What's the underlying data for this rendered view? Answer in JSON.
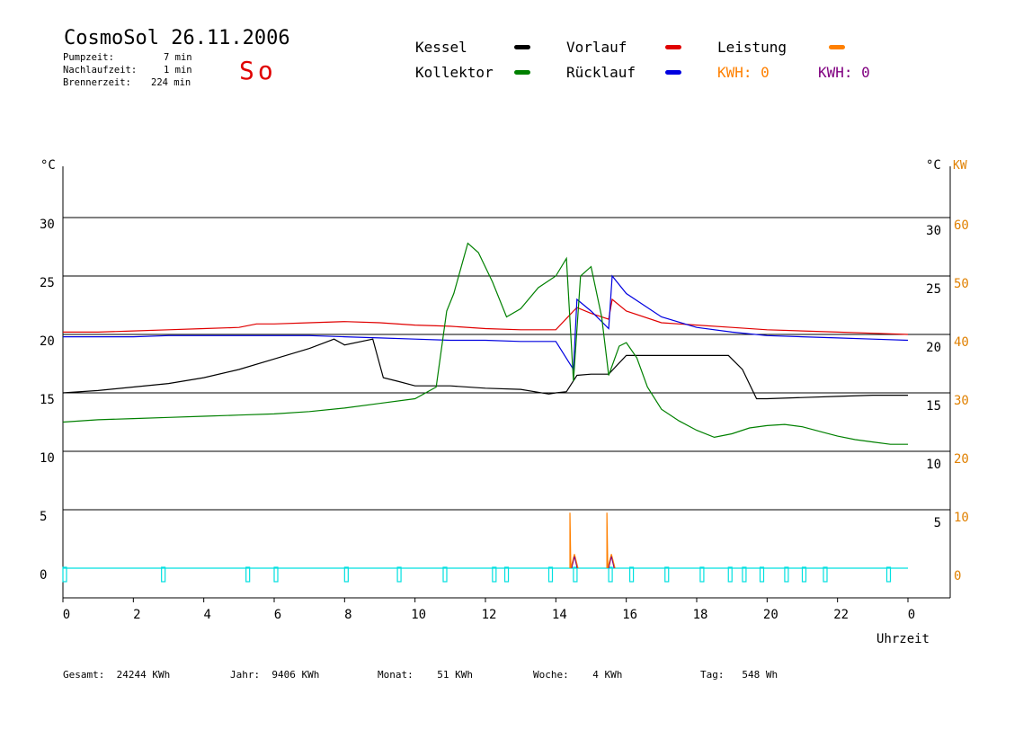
{
  "header": {
    "title": "CosmoSol 26.11.2006",
    "day": "So",
    "stats": [
      {
        "label": "Pumpzeit:",
        "value": "7 min"
      },
      {
        "label": "Nachlaufzeit:",
        "value": "1 min"
      },
      {
        "label": "Brennerzeit:",
        "value": "224 min"
      }
    ]
  },
  "legend": {
    "kessel": "Kessel",
    "kollektor": "Kollektor",
    "vorlauf": "Vorlauf",
    "ruecklauf": "Rücklauf",
    "leistung": "Leistung",
    "kwh1": "KWH: 0",
    "kwh2": "KWH: 0"
  },
  "colors": {
    "kessel": "#000000",
    "kollektor": "#008000",
    "vorlauf": "#e00000",
    "ruecklauf": "#0000e0",
    "leistung": "#ff8000",
    "kwh2": "#800080",
    "pump": "#00e0e0"
  },
  "footer": {
    "gesamt": "Gesamt:  24244 KWh",
    "jahr": "Jahr:  9406 KWh",
    "monat": "Monat:    51 KWh",
    "woche": "Woche:    4 KWh",
    "tag": "Tag:   548 Wh"
  },
  "chart_data": {
    "type": "line",
    "xlabel": "Uhrzeit",
    "ylabel_left": "°C",
    "ylabel_right": [
      "°C",
      "KW"
    ],
    "xlim": [
      0,
      24
    ],
    "ylim": [
      -2.5,
      35
    ],
    "x_ticks": [
      "0",
      "2",
      "4",
      "6",
      "8",
      "10",
      "12",
      "14",
      "16",
      "18",
      "20",
      "22",
      "0"
    ],
    "y_ticks_left": [
      "0",
      "5",
      "10",
      "15",
      "20",
      "25",
      "30"
    ],
    "y_ticks_right_c": [
      "5",
      "10",
      "15",
      "20",
      "25",
      "30"
    ],
    "y_ticks_right_kw": [
      "0",
      "10",
      "20",
      "30",
      "40",
      "50",
      "60"
    ],
    "grid": "horizontal",
    "series": [
      {
        "name": "Vorlauf",
        "color": "#e00000",
        "x": [
          0,
          1,
          2,
          3,
          4,
          5,
          5.5,
          6,
          7,
          8,
          9,
          10,
          11,
          12,
          13,
          14,
          14.5,
          14.6,
          15,
          15.5,
          15.6,
          16,
          17,
          18,
          19,
          20,
          21,
          22,
          23,
          24
        ],
        "y": [
          20.2,
          20.2,
          20.3,
          20.4,
          20.5,
          20.6,
          20.9,
          20.9,
          21.0,
          21.1,
          21.0,
          20.8,
          20.7,
          20.5,
          20.4,
          20.4,
          22.0,
          22.3,
          21.8,
          21.3,
          23.0,
          22.0,
          21.0,
          20.8,
          20.6,
          20.4,
          20.3,
          20.2,
          20.1,
          20.0
        ]
      },
      {
        "name": "Rücklauf",
        "color": "#0000e0",
        "x": [
          0,
          1,
          2,
          3,
          4,
          5,
          6,
          7,
          8,
          9,
          10,
          11,
          12,
          13,
          14,
          14.5,
          14.6,
          15,
          15.5,
          15.6,
          16,
          17,
          18,
          19,
          20,
          21,
          22,
          23,
          24
        ],
        "y": [
          19.8,
          19.8,
          19.8,
          19.9,
          19.9,
          19.9,
          19.9,
          19.9,
          19.8,
          19.7,
          19.6,
          19.5,
          19.5,
          19.4,
          19.4,
          17.0,
          23.0,
          22.0,
          20.5,
          25.0,
          23.5,
          21.5,
          20.6,
          20.2,
          19.9,
          19.8,
          19.7,
          19.6,
          19.5
        ]
      },
      {
        "name": "Kessel",
        "color": "#000000",
        "x": [
          0,
          1,
          2,
          3,
          4,
          5,
          6,
          7,
          7.7,
          8,
          8.8,
          9.1,
          9.5,
          10,
          11,
          12,
          13,
          13.8,
          14,
          14.3,
          14.6,
          15,
          15.5,
          16,
          17,
          18,
          18.9,
          19.3,
          19.7,
          20,
          21,
          22,
          23,
          24
        ],
        "y": [
          15.0,
          15.2,
          15.5,
          15.8,
          16.3,
          17.0,
          17.9,
          18.8,
          19.6,
          19.1,
          19.6,
          16.3,
          16.0,
          15.6,
          15.6,
          15.4,
          15.3,
          14.9,
          15.0,
          15.1,
          16.5,
          16.6,
          16.6,
          18.2,
          18.2,
          18.2,
          18.2,
          17.0,
          14.5,
          14.5,
          14.6,
          14.7,
          14.8,
          14.8
        ]
      },
      {
        "name": "Kollektor",
        "color": "#008000",
        "x": [
          0,
          1,
          2,
          3,
          4,
          5,
          6,
          7,
          8,
          9,
          10,
          10.6,
          10.9,
          11.1,
          11.5,
          11.8,
          12.2,
          12.6,
          13,
          13.5,
          14,
          14.3,
          14.5,
          14.7,
          15,
          15.3,
          15.5,
          15.8,
          16,
          16.3,
          16.6,
          17,
          17.5,
          18,
          18.5,
          19,
          19.5,
          20,
          20.5,
          21,
          21.5,
          22,
          22.5,
          23,
          23.5,
          24
        ],
        "y": [
          12.5,
          12.7,
          12.8,
          12.9,
          13.0,
          13.1,
          13.2,
          13.4,
          13.7,
          14.1,
          14.5,
          15.5,
          22.0,
          23.5,
          27.8,
          27.0,
          24.5,
          21.5,
          22.2,
          24.0,
          25.0,
          26.5,
          16.0,
          25.0,
          25.8,
          21.5,
          16.5,
          19.0,
          19.3,
          18.0,
          15.5,
          13.6,
          12.6,
          11.8,
          11.2,
          11.5,
          12.0,
          12.2,
          12.3,
          12.1,
          11.7,
          11.3,
          11.0,
          10.8,
          10.6,
          10.6
        ]
      }
    ],
    "power_peaks_kw": [
      {
        "x": 14.4,
        "y": 9.5
      },
      {
        "x": 15.45,
        "y": 9.5
      }
    ],
    "pump_pulses_h": [
      0,
      2.8,
      5.2,
      6.0,
      8.0,
      9.5,
      10.8,
      12.2,
      12.55,
      13.8,
      14.5,
      15.5,
      16.1,
      17.1,
      18.1,
      18.9,
      19.3,
      19.8,
      20.5,
      21.0,
      21.6,
      23.4
    ]
  }
}
